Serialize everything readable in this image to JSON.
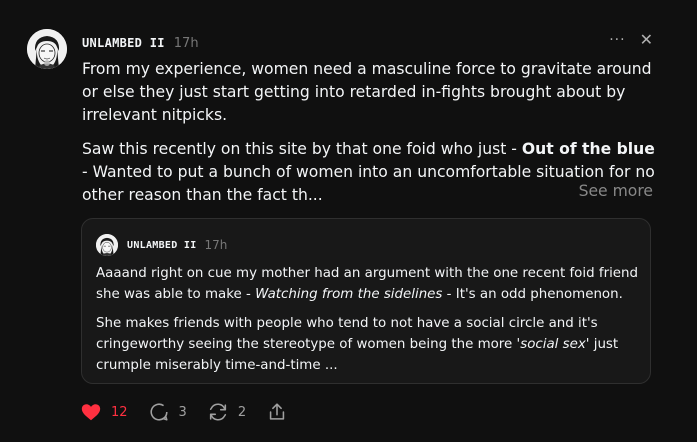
{
  "post": {
    "username": "UNLAMBED II",
    "time": "17h",
    "p1": "From my experience, women need a masculine force to gravitate around or else they just start getting into retarded in-fights brought about by irrelevant nitpicks.",
    "p2_before": "Saw this recently on this site by that one foid who just - ",
    "p2_bold": "Out of the blue",
    "p2_after": " - Wanted to put a bunch of women into an uncomfortable situation for no other reason than the fact th...",
    "see_more": "See more",
    "more_icon": "···",
    "close_icon": "✕"
  },
  "quote": {
    "username": "UNLAMBED II",
    "time": "17h",
    "p1_before": "Aaaand right on cue my mother had an argument with the one recent foid friend she was able to make - ",
    "p1_italic": "Watching from the sidelines",
    "p1_after": " - It's an odd phenomenon.",
    "p2_before": "She makes friends with people who tend to not have a social circle and it's cringeworthy seeing the stereotype of women being the more ",
    "p2_italic": "'social sex'",
    "p2_after": " just crumple miserably time-and-time ..."
  },
  "actions": {
    "likes": "12",
    "comments": "3",
    "reposts": "2"
  },
  "colors": {
    "like": "#ff3040",
    "background": "#101010"
  }
}
